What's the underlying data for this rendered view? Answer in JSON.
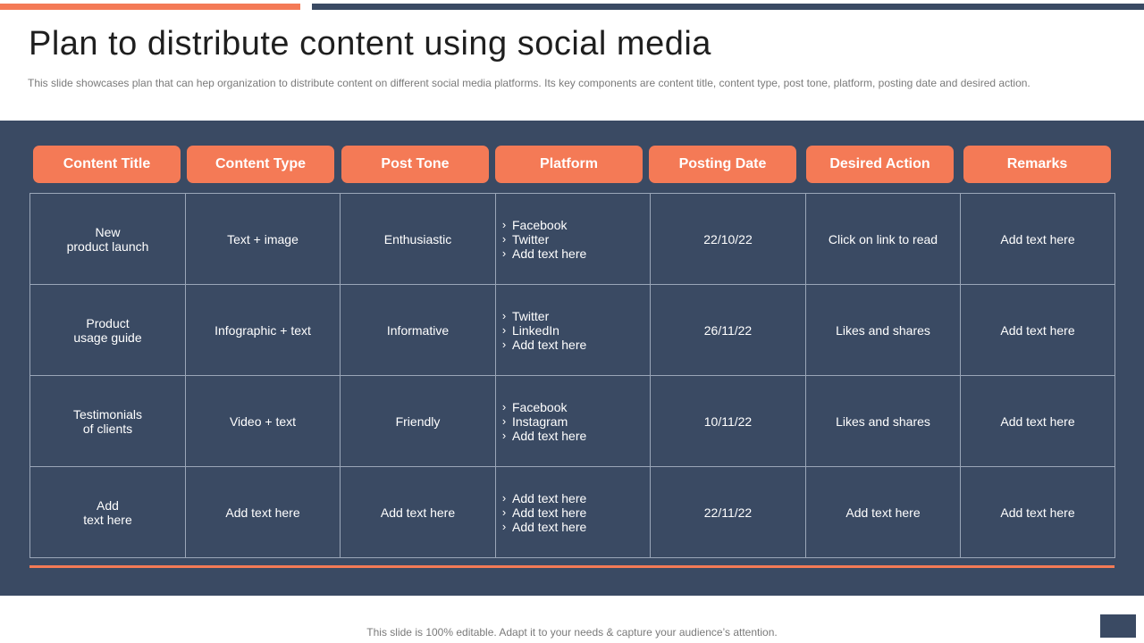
{
  "slide": {
    "title": "Plan to distribute content using social media",
    "subtitle": "This slide showcases plan that can hep organization to distribute content on different social media platforms. Its key components are content title, content type,  post tone,  platform, posting date and desired action.",
    "footer": "This slide is 100% editable. Adapt it to your needs & capture your audience’s attention."
  },
  "colors": {
    "accent": "#f47a56",
    "navy": "#3a4a63",
    "grid_line": "#9aa6b8"
  },
  "icons": {
    "bullet": "chevron-right-icon"
  },
  "table": {
    "headers": [
      "Content Title",
      "Content Type",
      "Post Tone",
      "Platform",
      "Posting Date",
      "Desired Action",
      "Remarks"
    ],
    "rows": [
      {
        "title": [
          "New",
          "product launch"
        ],
        "type": "Text + image",
        "tone": "Enthusiastic",
        "platforms": [
          "Facebook",
          "Twitter",
          "Add text here"
        ],
        "date": "22/10/22",
        "action": "Click on link to read",
        "remarks": "Add text here"
      },
      {
        "title": [
          "Product",
          "usage guide"
        ],
        "type": "Infographic  + text",
        "tone": "Informative",
        "platforms": [
          "Twitter",
          "LinkedIn",
          "Add text here"
        ],
        "date": "26/11/22",
        "action": "Likes and shares",
        "remarks": "Add text here"
      },
      {
        "title": [
          "Testimonials",
          "of clients"
        ],
        "type": "Video + text",
        "tone": "Friendly",
        "platforms": [
          "Facebook",
          "Instagram",
          "Add text here"
        ],
        "date": "10/11/22",
        "action": "Likes and shares",
        "remarks": "Add text here"
      },
      {
        "title": [
          "Add",
          "text here"
        ],
        "type": "Add text here",
        "tone": "Add text here",
        "platforms": [
          "Add text here",
          "Add text here",
          "Add text here"
        ],
        "date": "22/11/22",
        "action": "Add text here",
        "remarks": "Add text here"
      }
    ]
  }
}
